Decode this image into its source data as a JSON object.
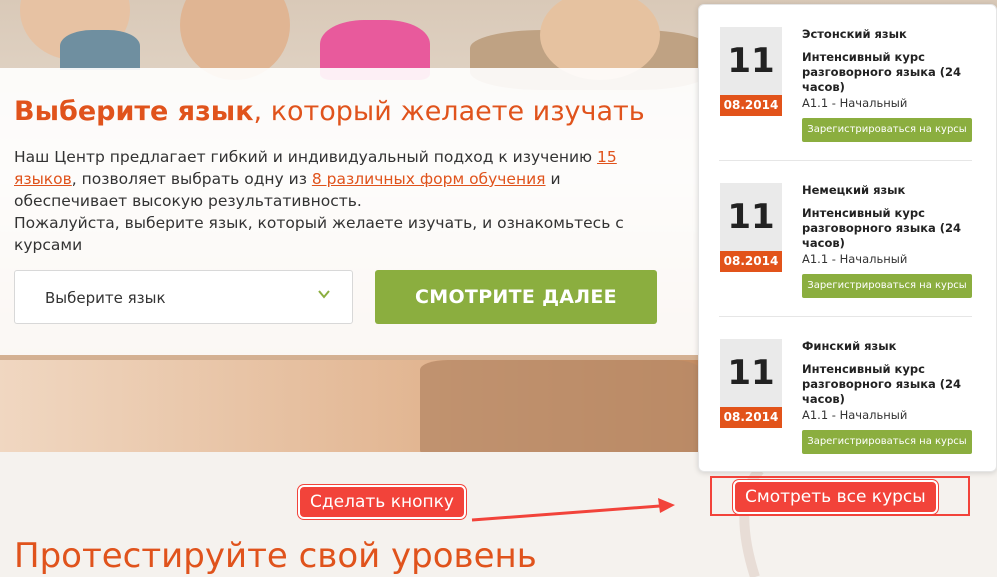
{
  "headline": {
    "bold": "Выберите язык",
    "rest": ", который желаете изучать"
  },
  "description": {
    "part1": "Наш Центр предлагает гибкий и индивидуальный подход к изучению ",
    "link1": "15 языков",
    "part2": ", позволяет выбрать одну из ",
    "link2": "8 различных форм обучения",
    "part3": " и обеспечивает высокую результативность.",
    "line2": "Пожалуйста, выберите язык, который желаете изучать, и ознакомьтесь с курсами"
  },
  "language_select": {
    "value": "Выберите язык"
  },
  "more_button": "СМОТРИТЕ ДАЛЕЕ",
  "courses": [
    {
      "day": "11",
      "month": "08.2014",
      "language": "Эстонский язык",
      "name": "Интенсивный курс разговорного языка (24 часов)",
      "level": "A1.1 - Начальный",
      "register": "Зарегистрироваться на курсы"
    },
    {
      "day": "11",
      "month": "08.2014",
      "language": "Немецкий язык",
      "name": "Интенсивный курс разговорного языка (24 часов)",
      "level": "A1.1 - Начальный",
      "register": "Зарегистрироваться на курсы"
    },
    {
      "day": "11",
      "month": "08.2014",
      "language": "Финский язык",
      "name": "Интенсивный курс разговорного языка (24 часов)",
      "level": "A1.1 - Начальный",
      "register": "Зарегистрироваться на курсы"
    }
  ],
  "annotations": {
    "make_button": "Сделать кнопку",
    "see_all": "Смотреть все курсы"
  },
  "test_title": "Протестируйте свой уровень",
  "colors": {
    "accent": "#e0531c",
    "green": "#8bae3f",
    "annotation": "#f2433a"
  }
}
